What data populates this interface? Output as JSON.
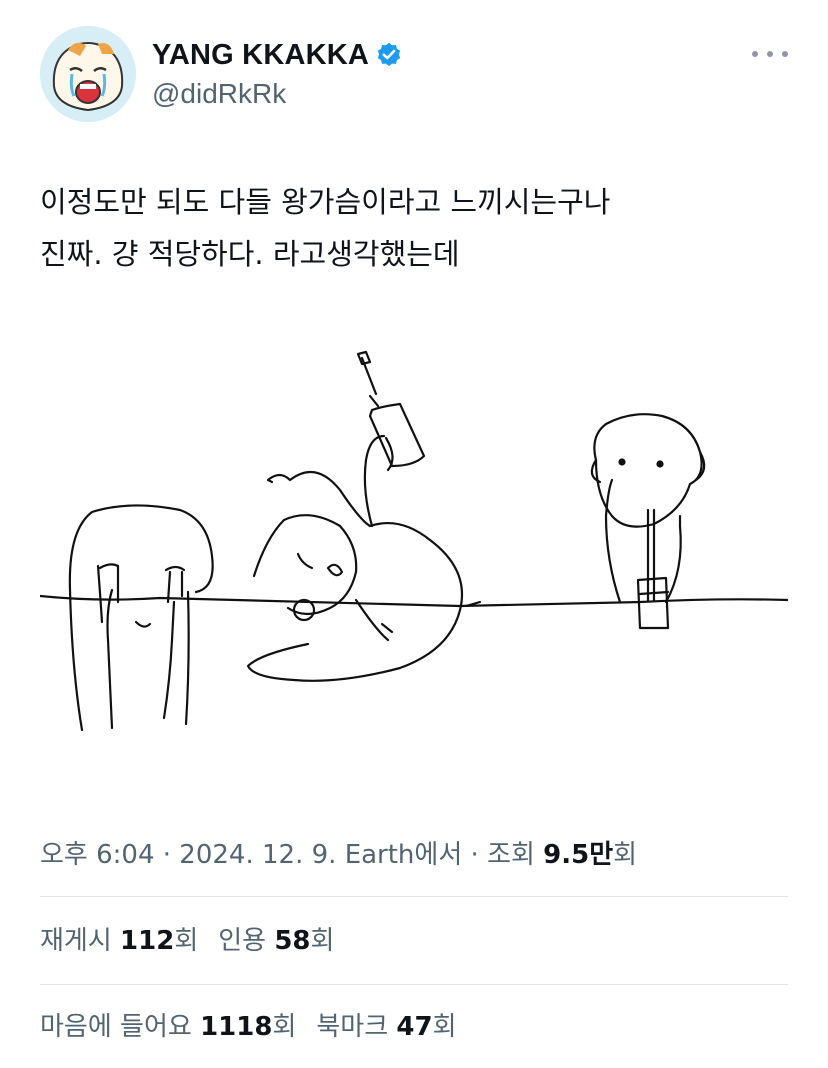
{
  "author": {
    "display_name": "YANG KKAKKA",
    "handle": "@didRkRk",
    "verified": true,
    "avatar": "crying-cartoon-face"
  },
  "tweet": {
    "lines": [
      "이정도만 되도 다들 왕가슴이라고 느끼시는구나",
      "진짜. 걍 적당하다. 라고생각했는데"
    ],
    "media_description_icon": "doodle-sketch-illustration"
  },
  "meta": {
    "time": "오후 6:04",
    "sep1": "·",
    "date": "2024. 12. 9.",
    "source": "Earth에서",
    "sep2": "·",
    "views_label": "조회",
    "views_value": "9.5만",
    "views_unit": "회"
  },
  "stats1": {
    "retweets_label": "재게시",
    "retweets_value": "112",
    "retweets_unit": "회",
    "quotes_label": "인용",
    "quotes_value": "58",
    "quotes_unit": "회"
  },
  "stats2": {
    "likes_label": "마음에 들어요",
    "likes_value": "1118",
    "likes_unit": "회",
    "bookmarks_label": "북마크",
    "bookmarks_value": "47",
    "bookmarks_unit": "회"
  },
  "colors": {
    "text": "#0f1419",
    "secondary": "#536471",
    "verified": "#1d9bf0",
    "avatar_bg": "#d8eef6"
  }
}
